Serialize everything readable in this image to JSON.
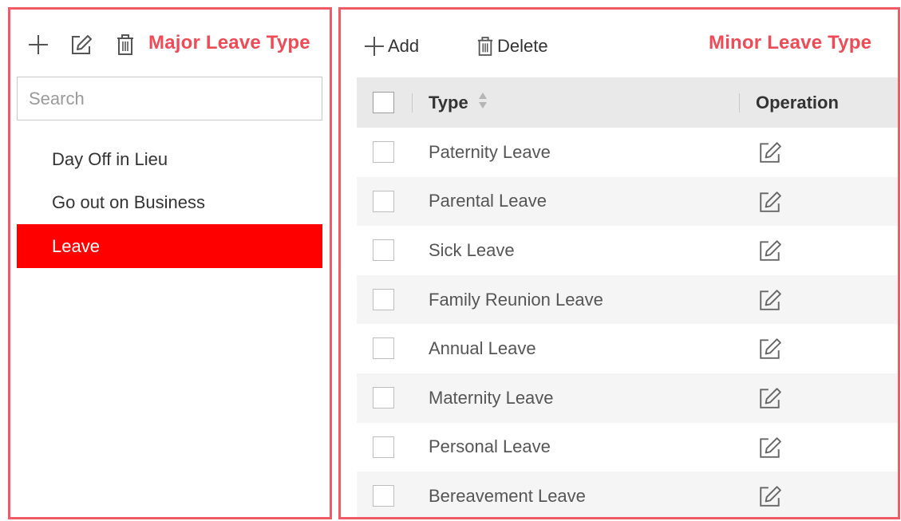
{
  "major_panel": {
    "title": "Major Leave Type",
    "toolbar_icons": [
      "plus-icon",
      "edit-icon",
      "trash-icon"
    ],
    "search": {
      "placeholder": "Search",
      "value": ""
    },
    "items": [
      {
        "label": "Day Off in Lieu",
        "selected": false
      },
      {
        "label": "Go out on Business",
        "selected": false
      },
      {
        "label": "Leave",
        "selected": true
      }
    ]
  },
  "minor_panel": {
    "title": "Minor Leave Type",
    "toolbar": {
      "add_label": "Add",
      "delete_label": "Delete"
    },
    "table": {
      "columns": {
        "type": "Type",
        "operation": "Operation"
      },
      "rows": [
        {
          "type": "Paternity Leave"
        },
        {
          "type": "Parental Leave"
        },
        {
          "type": "Sick Leave"
        },
        {
          "type": "Family Reunion Leave"
        },
        {
          "type": "Annual Leave"
        },
        {
          "type": "Maternity Leave"
        },
        {
          "type": "Personal Leave"
        },
        {
          "type": "Bereavement Leave"
        }
      ]
    }
  },
  "colors": {
    "annotation_border": "#ef5b66",
    "annotation_text": "#ef4b57",
    "selected_background": "#ff0000",
    "header_background": "#e9e9e9",
    "row_alt_background": "#f5f5f5"
  }
}
